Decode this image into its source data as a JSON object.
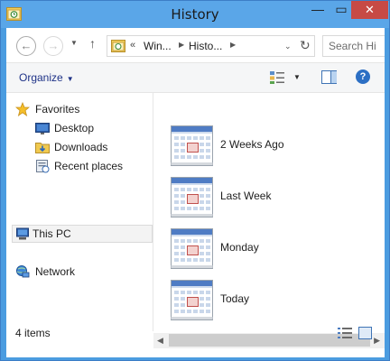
{
  "window": {
    "title": "History"
  },
  "title_controls": {
    "minimize": "—",
    "maximize": "▭",
    "close": "✕"
  },
  "address_bar": {
    "overflow": "«",
    "crumbs": [
      "Win...",
      "Histo..."
    ]
  },
  "search": {
    "placeholder": "Search Hi"
  },
  "command_bar": {
    "organize_label": "Organize"
  },
  "nav_pane": {
    "favorites_label": "Favorites",
    "favorites": [
      "Desktop",
      "Downloads",
      "Recent places"
    ],
    "this_pc_label": "This PC",
    "network_label": "Network"
  },
  "files": [
    {
      "name": "2 Weeks Ago",
      "icon": "calendar-icon"
    },
    {
      "name": "Last Week",
      "icon": "calendar-icon"
    },
    {
      "name": "Monday",
      "icon": "calendar-icon"
    },
    {
      "name": "Today",
      "icon": "calendar-icon"
    }
  ],
  "status": {
    "item_count": "4 items"
  },
  "colors": {
    "title_bar": "#5aa6e8",
    "close_button": "#c74a45",
    "link_blue": "#1e3287"
  }
}
